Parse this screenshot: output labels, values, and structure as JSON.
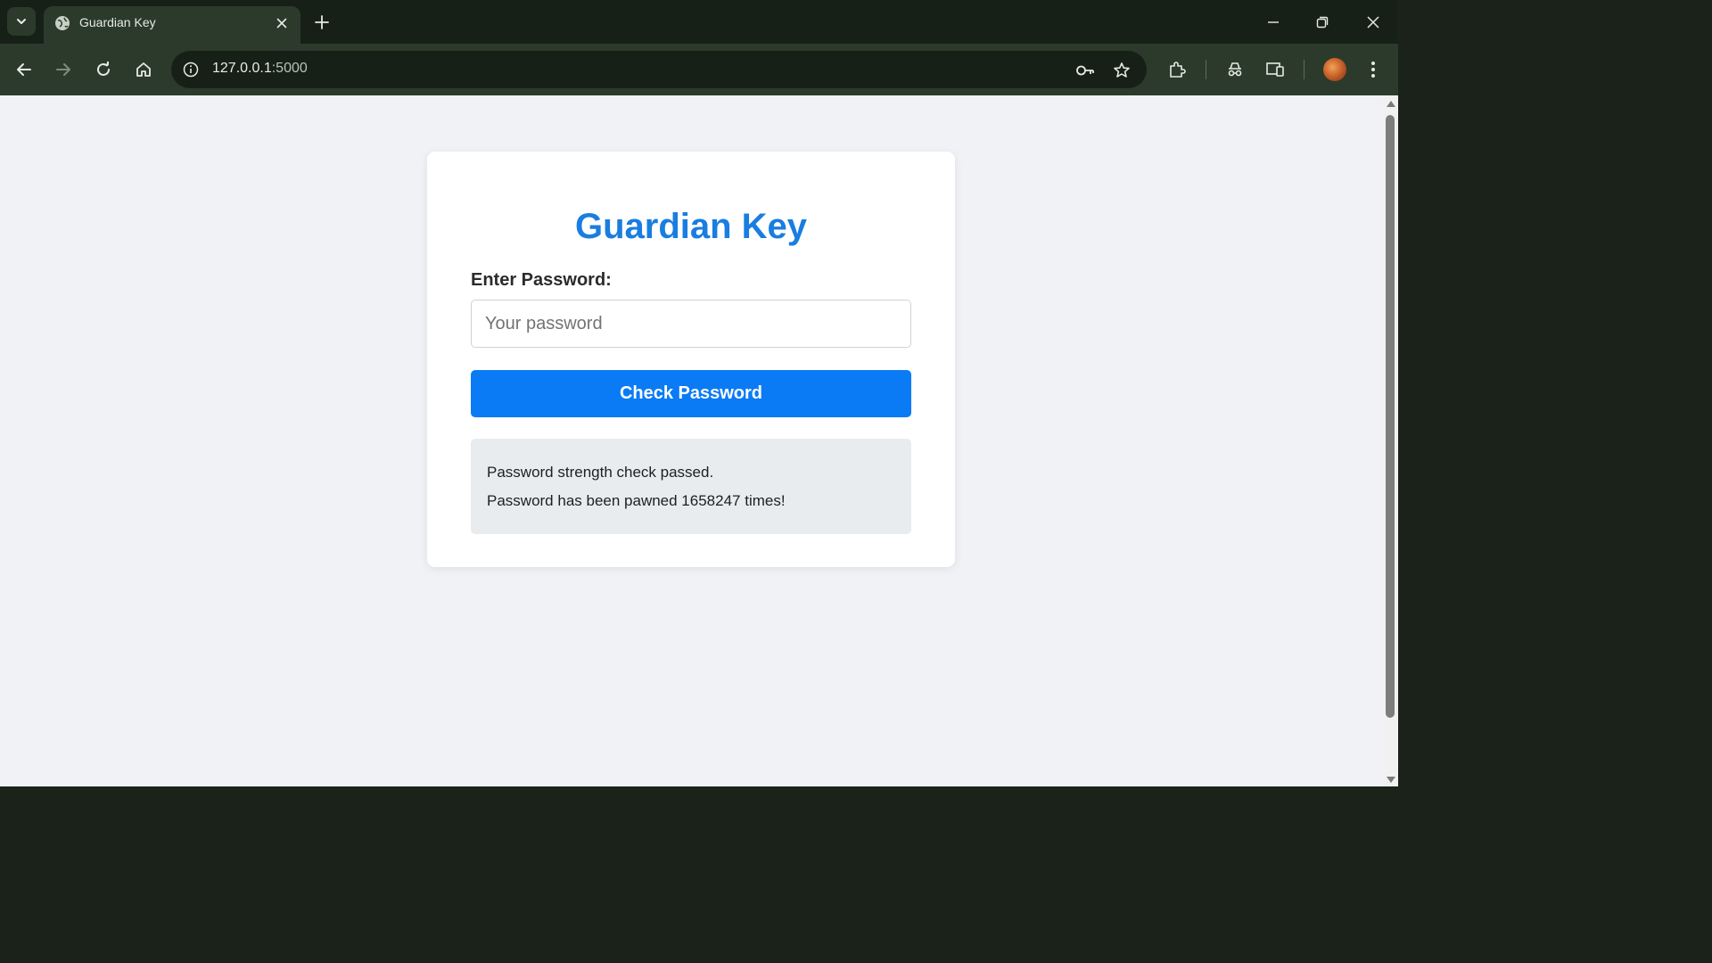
{
  "browser": {
    "tab": {
      "title": "Guardian Key"
    },
    "address_bar": {
      "url_host": "127.0.0.1",
      "url_port": ":5000"
    }
  },
  "page": {
    "heading": "Guardian Key",
    "password_label": "Enter Password:",
    "password_input": {
      "value": "",
      "placeholder": "Your password"
    },
    "check_button_label": "Check Password",
    "result": {
      "line1": "Password strength check passed.",
      "line2": "Password has been pawned 1658247 times!"
    }
  },
  "colors": {
    "accent": "#0a7bf5",
    "heading": "#1a7de0",
    "page_background": "#f0f2f5",
    "result_background": "#e9ecef",
    "browser_frame": "#2c3a2b"
  }
}
